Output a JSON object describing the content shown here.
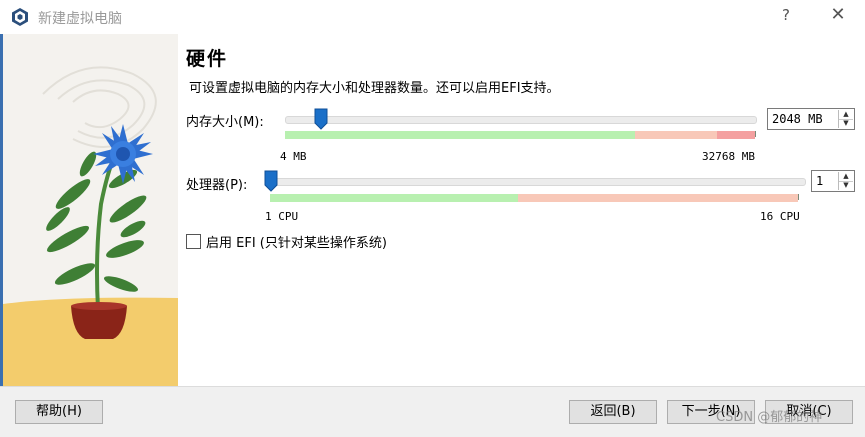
{
  "window": {
    "title": "新建虚拟电脑",
    "help_icon_label": "?",
    "close_icon_label": "✕"
  },
  "content": {
    "section_title": "硬件",
    "description": "可设置虚拟电脑的内存大小和处理器数量。还可以启用EFI支持。"
  },
  "memory": {
    "label": "内存大小(M):",
    "value": "2048 MB",
    "min_label": "4 MB",
    "max_label": "32768 MB",
    "slider_fraction": 0.0624
  },
  "processor": {
    "label": "处理器(P):",
    "value": "1",
    "min_label": "1 CPU",
    "max_label": "16 CPU",
    "slider_fraction": 0.0
  },
  "efi": {
    "checked": false,
    "label": "启用 EFI (只针对某些操作系统)"
  },
  "buttons": {
    "help": "帮助(H)",
    "back": "返回(B)",
    "next": "下一步(N)",
    "cancel": "取消(C)"
  },
  "watermark": "CSDN @郁郁的神",
  "colors": {
    "green_zone": "#b8f0b0",
    "red_zone": "#f8c8b8",
    "deep_red_zone": "#f4a0a0",
    "thumb": "#1a6fc8",
    "accent": "#3a6fb0"
  }
}
